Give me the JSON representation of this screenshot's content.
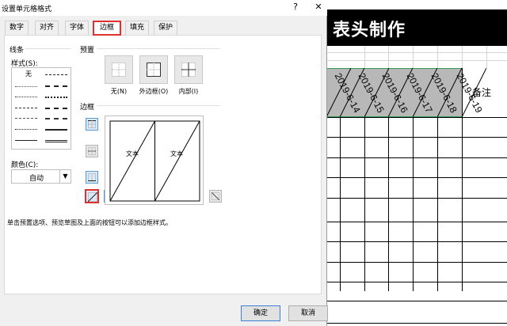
{
  "dialog": {
    "title": "设置单元格格式",
    "help_glyph": "?",
    "close_glyph": "✕",
    "tabs": [
      {
        "label": "数字"
      },
      {
        "label": "对齐"
      },
      {
        "label": "字体"
      },
      {
        "label": "边框",
        "active": true
      },
      {
        "label": "填充"
      },
      {
        "label": "保护"
      }
    ],
    "line_section": {
      "title": "线条",
      "style_label": "样式(S):",
      "none_label": "无",
      "color_label": "颜色(C):",
      "color_value": "自动"
    },
    "preset_section": {
      "title": "预置",
      "presets": [
        {
          "label": "无(N)"
        },
        {
          "label": "外边框(O)"
        },
        {
          "label": "内部(I)"
        }
      ]
    },
    "border_section": {
      "title": "边框",
      "preview_text_left": "文本",
      "preview_text_right": "文本",
      "active_border": "diagonal-up"
    },
    "hint": "单击预置选项、预览草图及上面的按钮可以添加边框样式。",
    "ok_label": "确定",
    "cancel_label": "取消"
  },
  "sheet": {
    "title": "表头制作",
    "header_dates": [
      "2019-6-14",
      "2019-6-15",
      "2019-6-16",
      "2019-6-17",
      "2019-6-18",
      "2019-6-19"
    ],
    "remark": "备注",
    "accent_color": "#2f9e5a"
  },
  "colors": {
    "highlight": "#e03030",
    "title_bar": "#000000",
    "header_fill": "#b8b8b8",
    "toggle_fill": "#dbe9f7"
  }
}
